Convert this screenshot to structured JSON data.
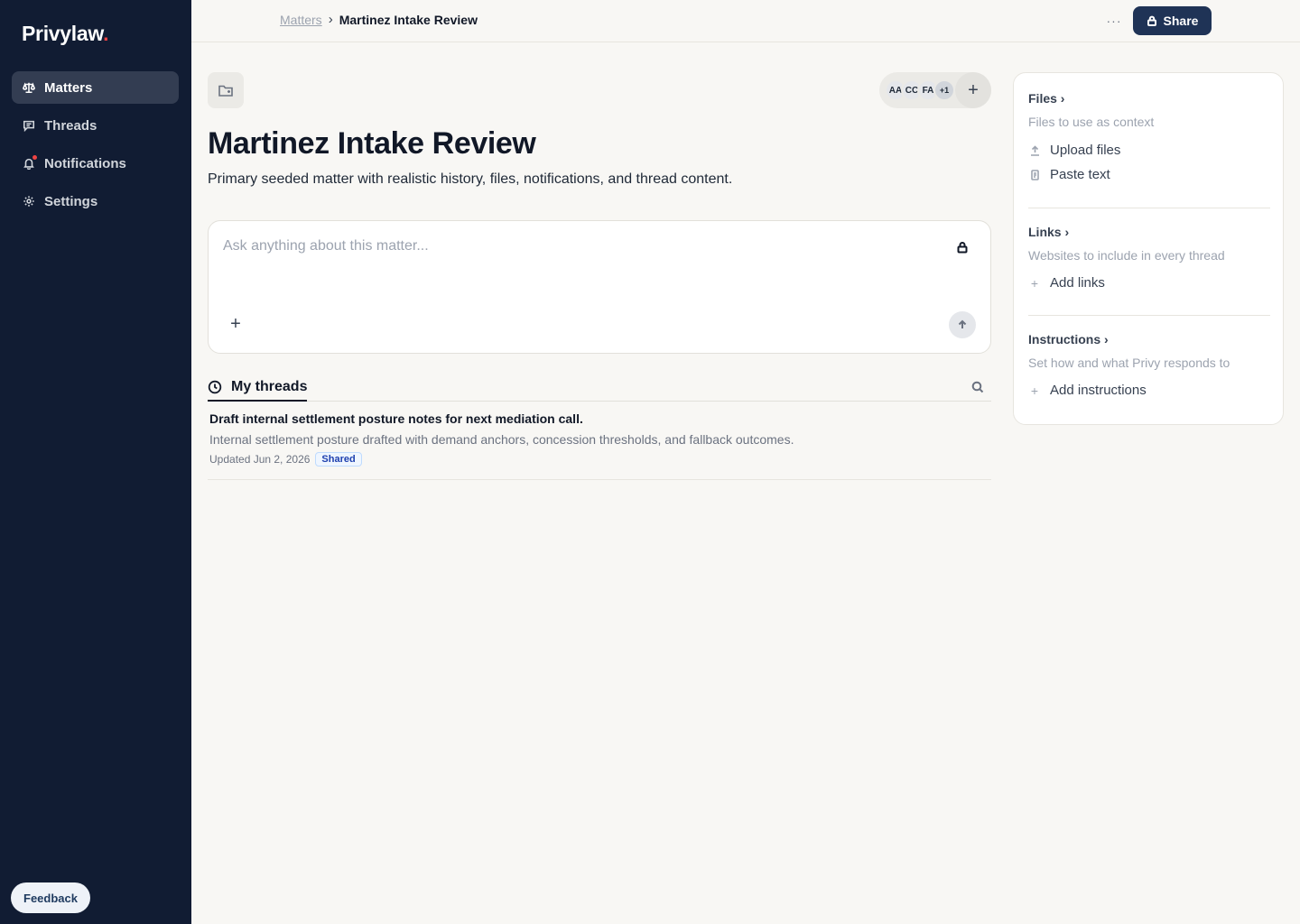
{
  "app": {
    "logo_text": "Privylaw",
    "logo_dot": ".",
    "accent": "#ef4444",
    "sidebar_bg": "#111c33"
  },
  "sidebar": {
    "items": [
      {
        "label": "Matters",
        "icon": "scale-icon",
        "active": true
      },
      {
        "label": "Threads",
        "icon": "chat-bubble-icon",
        "active": false
      },
      {
        "label": "Notifications",
        "icon": "bell-icon",
        "active": false
      },
      {
        "label": "Settings",
        "icon": "gear-icon",
        "active": false
      }
    ],
    "feedback_label": "Feedback"
  },
  "topbar": {
    "breadcrumb_parent": "Matters",
    "breadcrumb_separator": "›",
    "breadcrumb_current": "Martinez Intake Review",
    "more_label": "···",
    "share_label": "Share"
  },
  "matter": {
    "title": "Martinez Intake Review",
    "description": "Primary seeded matter with realistic history, files, notifications, and thread content.",
    "members": [
      "AA",
      "CC",
      "FA"
    ],
    "members_more": "+1",
    "add_member_label": "+"
  },
  "composer": {
    "placeholder": "Ask anything about this matter...",
    "value": "",
    "attach_label": "+"
  },
  "threads": {
    "tab_label": "My threads",
    "items": [
      {
        "title": "Draft internal settlement posture notes for next mediation call.",
        "summary": "Internal settlement posture drafted with demand anchors, concession thresholds, and fallback outcomes.",
        "updated": "Updated Jun 2, 2026",
        "badge": "Shared"
      }
    ]
  },
  "panel": {
    "files": {
      "title": "Files ›",
      "subtitle": "Files to use as context",
      "actions": [
        "Upload files",
        "Paste text"
      ]
    },
    "links": {
      "title": "Links ›",
      "subtitle": "Websites to include in every thread",
      "action": "Add links"
    },
    "instructions": {
      "title": "Instructions ›",
      "subtitle": "Set how and what Privy responds to",
      "action": "Add instructions"
    }
  }
}
